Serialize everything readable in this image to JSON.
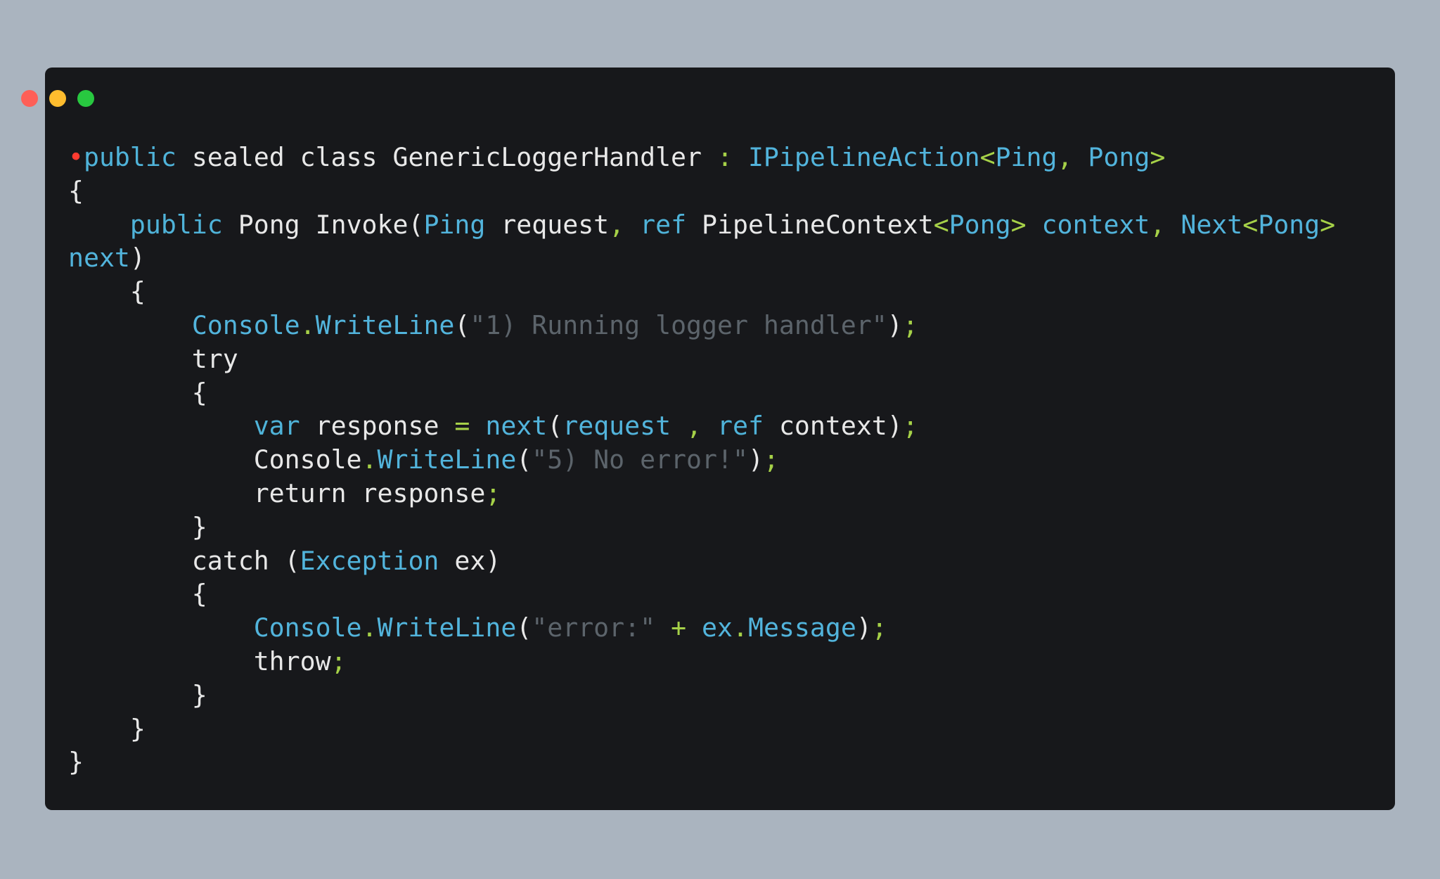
{
  "window": {
    "buttons": [
      {
        "name": "close",
        "color": "#fe5f57"
      },
      {
        "name": "minimize",
        "color": "#febc2e"
      },
      {
        "name": "maximize",
        "color": "#28c840"
      }
    ]
  },
  "colors": {
    "background": "#aab4bf",
    "editor": "#17181b",
    "plain": "#e8e8e8",
    "keyword": "#4fb3d9",
    "punctuation": "#a6d148",
    "string": "#5c646b",
    "marker": "#ff3b30"
  },
  "code": {
    "lines": [
      [
        [
          "marker",
          "•"
        ],
        [
          "kw",
          "public"
        ],
        [
          "plain",
          " sealed class GenericLoggerHandler "
        ],
        [
          "punct",
          ":"
        ],
        [
          "plain",
          " "
        ],
        [
          "type",
          "IPipelineAction"
        ],
        [
          "punct",
          "<"
        ],
        [
          "type",
          "Ping"
        ],
        [
          "punct",
          ","
        ],
        [
          "plain",
          " "
        ],
        [
          "type",
          "Pong"
        ],
        [
          "punct",
          ">"
        ]
      ],
      [
        [
          "plain",
          "{"
        ]
      ],
      [
        [
          "plain",
          "    "
        ],
        [
          "kw",
          "public"
        ],
        [
          "plain",
          " Pong Invoke("
        ],
        [
          "type",
          "Ping"
        ],
        [
          "plain",
          " request"
        ],
        [
          "punct",
          ","
        ],
        [
          "plain",
          " "
        ],
        [
          "kw",
          "ref"
        ],
        [
          "plain",
          " PipelineContext"
        ],
        [
          "punct",
          "<"
        ],
        [
          "type",
          "Pong"
        ],
        [
          "punct",
          ">"
        ],
        [
          "plain",
          " "
        ],
        [
          "type",
          "context"
        ],
        [
          "punct",
          ","
        ],
        [
          "plain",
          " "
        ],
        [
          "type",
          "Next"
        ],
        [
          "punct",
          "<"
        ],
        [
          "type",
          "Pong"
        ],
        [
          "punct",
          ">"
        ]
      ],
      [
        [
          "type",
          "next"
        ],
        [
          "plain",
          ")"
        ]
      ],
      [
        [
          "plain",
          "    {"
        ]
      ],
      [
        [
          "plain",
          "        "
        ],
        [
          "type",
          "Console"
        ],
        [
          "punct",
          "."
        ],
        [
          "type",
          "WriteLine"
        ],
        [
          "plain",
          "("
        ],
        [
          "string",
          "\"1) Running logger handler\""
        ],
        [
          "plain",
          ")"
        ],
        [
          "punct",
          ";"
        ]
      ],
      [
        [
          "plain",
          "        try"
        ]
      ],
      [
        [
          "plain",
          "        {"
        ]
      ],
      [
        [
          "plain",
          "            "
        ],
        [
          "kw",
          "var"
        ],
        [
          "plain",
          " response "
        ],
        [
          "punct",
          "="
        ],
        [
          "plain",
          " "
        ],
        [
          "type",
          "next"
        ],
        [
          "plain",
          "("
        ],
        [
          "type",
          "request"
        ],
        [
          "plain",
          " "
        ],
        [
          "punct",
          ","
        ],
        [
          "plain",
          " "
        ],
        [
          "kw",
          "ref"
        ],
        [
          "plain",
          " context)"
        ],
        [
          "punct",
          ";"
        ]
      ],
      [
        [
          "plain",
          "            Console"
        ],
        [
          "punct",
          "."
        ],
        [
          "type",
          "WriteLine"
        ],
        [
          "plain",
          "("
        ],
        [
          "string",
          "\"5) No error!\""
        ],
        [
          "plain",
          ")"
        ],
        [
          "punct",
          ";"
        ]
      ],
      [
        [
          "plain",
          "            return response"
        ],
        [
          "punct",
          ";"
        ]
      ],
      [
        [
          "plain",
          "        }"
        ]
      ],
      [
        [
          "plain",
          "        catch ("
        ],
        [
          "type",
          "Exception"
        ],
        [
          "plain",
          " ex)"
        ]
      ],
      [
        [
          "plain",
          "        {"
        ]
      ],
      [
        [
          "plain",
          "            "
        ],
        [
          "type",
          "Console"
        ],
        [
          "punct",
          "."
        ],
        [
          "type",
          "WriteLine"
        ],
        [
          "plain",
          "("
        ],
        [
          "string",
          "\"error:\""
        ],
        [
          "plain",
          " "
        ],
        [
          "punct",
          "+"
        ],
        [
          "plain",
          " "
        ],
        [
          "type",
          "ex"
        ],
        [
          "punct",
          "."
        ],
        [
          "type",
          "Message"
        ],
        [
          "plain",
          ")"
        ],
        [
          "punct",
          ";"
        ]
      ],
      [
        [
          "plain",
          "            throw"
        ],
        [
          "punct",
          ";"
        ]
      ],
      [
        [
          "plain",
          "        }"
        ]
      ],
      [
        [
          "plain",
          "    }"
        ]
      ],
      [
        [
          "plain",
          "}"
        ]
      ]
    ]
  }
}
